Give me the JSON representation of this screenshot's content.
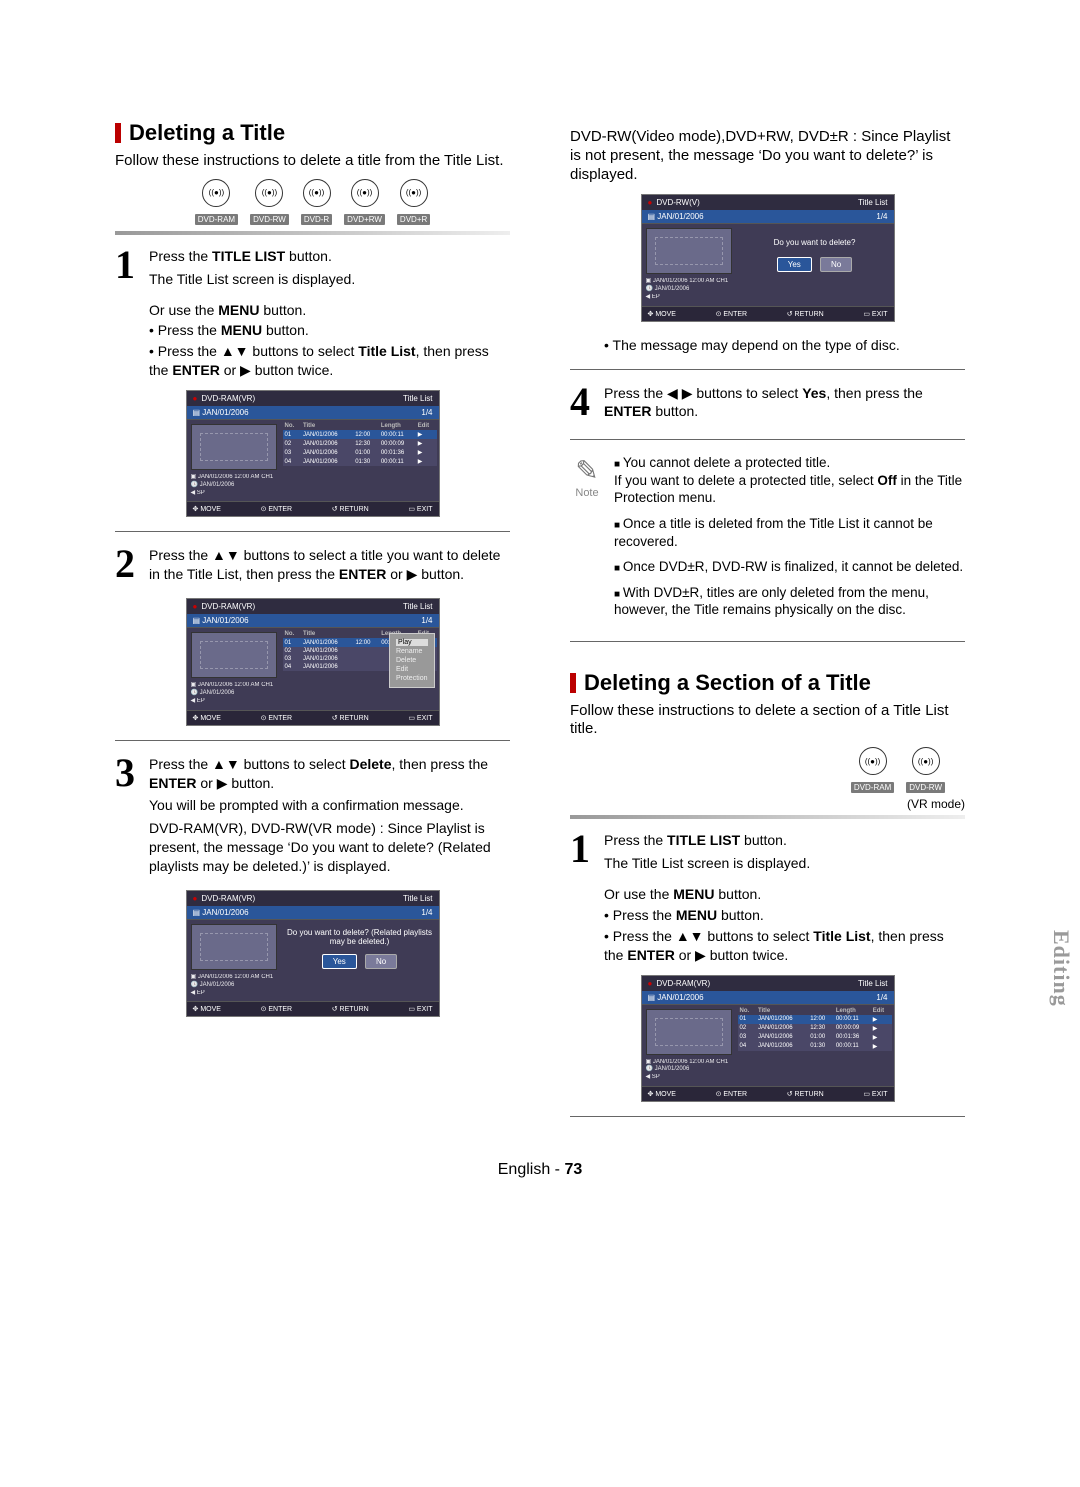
{
  "section1": {
    "title": "Deleting a Title",
    "intro": "Follow these instructions to delete a title from the Title List.",
    "discs": [
      "DVD-RAM",
      "DVD-RW",
      "DVD-R",
      "DVD+RW",
      "DVD+R"
    ],
    "step1a": "Press the ",
    "step1b": "TITLE LIST",
    "step1c": " button.",
    "step1d": "The Title List screen is displayed.",
    "menu1": "Or use the ",
    "menu1b": "MENU",
    "menu1c": " button.",
    "menu2a": "Press the ",
    "menu2b": "MENU",
    "menu2c": " button.",
    "menu3a": "Press the ",
    "menu3b": " buttons to select ",
    "menu3c": "Title List",
    "menu3d": ", then press the ",
    "menu3e": "ENTER",
    "menu3f": " or ",
    "menu3g": " button twice.",
    "step2a": "Press the ",
    "step2b": " buttons to select a title you want to delete in the Title List, then press the ",
    "step2c": "ENTER",
    "step2d": " or ",
    "step2e": " button.",
    "step3a": "Press the ",
    "step3b": " buttons to select ",
    "step3c": "Delete",
    "step3d": ", then press the ",
    "step3e": "ENTER",
    "step3f": " or ",
    "step3g": " button.",
    "step3h": "You will be prompted with a confirmation message.",
    "step3i": "DVD-RAM(VR), DVD-RW(VR mode) : Since Playlist is present, the message ‘Do you want to delete? (Related playlists may be deleted.)’ is displayed.",
    "step3j": "DVD-RW(Video mode),DVD+RW, DVD±R : Since Playlist is not present, the message ‘Do you want to delete?’ is displayed.",
    "msgdep": "The message may depend on the type of disc.",
    "step4a": "Press the ",
    "step4b": " buttons to select ",
    "step4c": "Yes",
    "step4d": ", then press the ",
    "step4e": "ENTER",
    "step4f": " button.",
    "notes": [
      "You cannot delete a protected title. If you want to delete a protected title, select Off in the Title Protection menu.",
      "Once a title is deleted from the Title List it cannot be recovered.",
      "Once DVD±R, DVD-RW is finalized, it cannot be deleted.",
      "With DVD±R, titles are only deleted from the menu, however, the Title remains physically on the disc."
    ],
    "note_label": "Note"
  },
  "section2": {
    "title": "Deleting a Section of a Title",
    "intro": "Follow these instructions to delete a section of a Title List title.",
    "discs": [
      "DVD-RAM",
      "DVD-RW"
    ],
    "vrmode": "(VR mode)",
    "step1a": "Press the ",
    "step1b": "TITLE LIST",
    "step1c": " button.",
    "step1d": "The Title List screen is displayed.",
    "menu1": "Or use the ",
    "menu1b": "MENU",
    "menu1c": " button.",
    "menu2a": "Press the ",
    "menu2b": "MENU",
    "menu2c": " button.",
    "menu3a": "Press the ",
    "menu3b": " buttons to select ",
    "menu3c": "Title List",
    "menu3d": ", then press the ",
    "menu3e": "ENTER",
    "menu3f": " or ",
    "menu3g": " button twice."
  },
  "osd": {
    "model_vr": "DVD-RAM(VR)",
    "model_v": "DVD-RW(V)",
    "titlelist": "Title List",
    "date": "JAN/01/2006",
    "page": "1/4",
    "cols": {
      "no": "No.",
      "title": "Title",
      "len": "Length",
      "edit": "Edit"
    },
    "rows": [
      {
        "no": "01",
        "t": "JAN/01/2006",
        "tm": "12:00",
        "len": "00:00:11",
        "e": "▶"
      },
      {
        "no": "02",
        "t": "JAN/01/2006",
        "tm": "12:30",
        "len": "00:00:09",
        "e": "▶"
      },
      {
        "no": "03",
        "t": "JAN/01/2006",
        "tm": "01:00",
        "len": "00:01:36",
        "e": "▶"
      },
      {
        "no": "04",
        "t": "JAN/01/2006",
        "tm": "01:30",
        "len": "00:00:11",
        "e": "▶"
      }
    ],
    "meta1": "JAN/01/2006 12:00 AM CH1",
    "meta2": "JAN/01/2006",
    "meta_sp": "SP",
    "meta_ep": "EP",
    "bar": {
      "move": "MOVE",
      "enter": "ENTER",
      "return": "RETURN",
      "exit": "EXIT"
    },
    "menu": [
      "Rename",
      "Delete",
      "Play",
      "Edit",
      "Protection"
    ],
    "q_vr": "Do you want to delete? (Related playlists may be deleted.)",
    "q_v": "Do you want to delete?",
    "yes": "Yes",
    "no": "No"
  },
  "ui": {
    "up_down": "▲▼",
    "left_right": "◀ ▶",
    "right": "▶"
  },
  "footer": {
    "lang": "English",
    "sep": " - ",
    "page": "73"
  },
  "sidetab": "Editing"
}
